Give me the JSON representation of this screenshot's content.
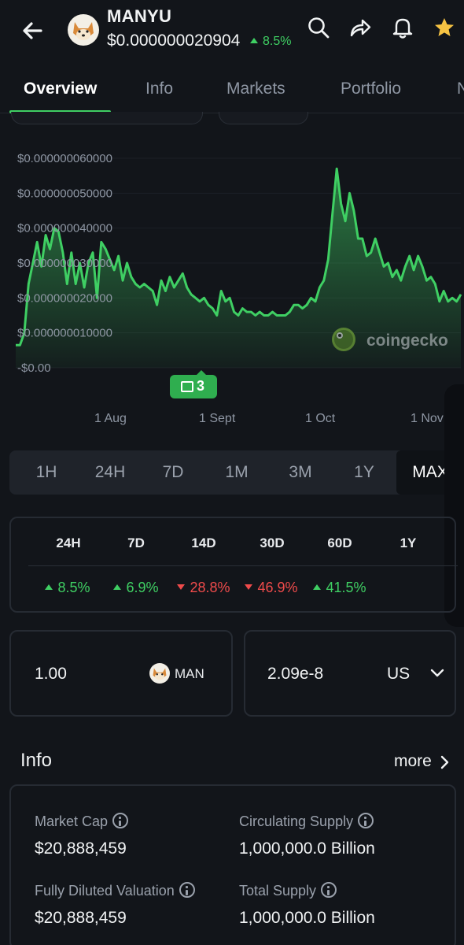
{
  "header": {
    "coin_name": "MANYU",
    "price": "$0.000000020904",
    "change_24h": "8.5%",
    "icons": [
      "back-arrow-icon",
      "search-icon",
      "share-icon",
      "bell-icon",
      "star-icon"
    ]
  },
  "tabs": [
    {
      "label": "Overview",
      "active": true
    },
    {
      "label": "Info",
      "active": false
    },
    {
      "label": "Markets",
      "active": false
    },
    {
      "label": "Portfolio",
      "active": false
    },
    {
      "label": "N",
      "active": false
    }
  ],
  "chart": {
    "watermark": "coingecko",
    "news_count": "3"
  },
  "chart_data": {
    "type": "area",
    "x_tick_labels": [
      "1 Aug",
      "1 Sept",
      "1 Oct",
      "1 Nov"
    ],
    "y_tick_labels": [
      "$0.000000060000",
      "$0.000000050000",
      "$0.000000040000",
      "$0.000000030000",
      "$0.000000020000",
      "$0.000000010000",
      "-$0.00"
    ],
    "ylim": [
      0,
      6e-08
    ],
    "grid": true,
    "color": "#3fcf63",
    "values": [
      6.5e-09,
      6.5e-09,
      1e-08,
      2.4e-08,
      3e-08,
      3.6e-08,
      2.9e-08,
      3.8e-08,
      3.4e-08,
      4e-08,
      3.9e-08,
      3.3e-08,
      2.4e-08,
      3.3e-08,
      2.4e-08,
      3e-08,
      2.3e-08,
      3e-08,
      3.3e-08,
      2e-08,
      3.6e-08,
      3.4e-08,
      3.1e-08,
      2.8e-08,
      3.2e-08,
      2.5e-08,
      3e-08,
      2.6e-08,
      2.4e-08,
      2.3e-08,
      2.4e-08,
      2.3e-08,
      2.2e-08,
      1.8e-08,
      2.5e-08,
      2.2e-08,
      2.6e-08,
      2.3e-08,
      2.5e-08,
      2.7e-08,
      2.3e-08,
      2.1e-08,
      2e-08,
      1.9e-08,
      2e-08,
      1.8e-08,
      1.7e-08,
      1.5e-08,
      2.2e-08,
      1.9e-08,
      2e-08,
      1.6e-08,
      1.5e-08,
      1.7e-08,
      1.6e-08,
      1.6e-08,
      1.5e-08,
      1.6e-08,
      1.5e-08,
      1.5e-08,
      1.6e-08,
      1.5e-08,
      1.5e-08,
      1.5e-08,
      1.6e-08,
      1.8e-08,
      1.8e-08,
      1.7e-08,
      1.8e-08,
      2e-08,
      1.9e-08,
      2.3e-08,
      2.5e-08,
      3.1e-08,
      4.4e-08,
      5.7e-08,
      4.7e-08,
      4.2e-08,
      5e-08,
      4.5e-08,
      3.7e-08,
      3.7e-08,
      3.2e-08,
      3.3e-08,
      3.7e-08,
      3.3e-08,
      2.9e-08,
      3e-08,
      2.6e-08,
      2.8e-08,
      2.5e-08,
      2.9e-08,
      3.2e-08,
      2.8e-08,
      3.2e-08,
      2.9e-08,
      2.5e-08,
      2.6e-08,
      2.4e-08,
      1.9e-08,
      2.2e-08,
      1.9e-08,
      2e-08,
      1.9e-08,
      2.1e-08
    ]
  },
  "time_ranges": [
    {
      "label": "1H",
      "active": false
    },
    {
      "label": "24H",
      "active": false
    },
    {
      "label": "7D",
      "active": false
    },
    {
      "label": "1M",
      "active": false
    },
    {
      "label": "3M",
      "active": false
    },
    {
      "label": "1Y",
      "active": false
    },
    {
      "label": "MAX",
      "active": true
    }
  ],
  "performance": [
    {
      "period": "24H",
      "change": "8.5%",
      "direction": "up"
    },
    {
      "period": "7D",
      "change": "6.9%",
      "direction": "up"
    },
    {
      "period": "14D",
      "change": "28.8%",
      "direction": "down"
    },
    {
      "period": "30D",
      "change": "46.9%",
      "direction": "down"
    },
    {
      "period": "60D",
      "change": "41.5%",
      "direction": "up"
    },
    {
      "period": "1Y",
      "change": "",
      "direction": "none"
    }
  ],
  "converter": {
    "amount": "1.00",
    "coin_symbol": "MAN",
    "value": "2.09e-8",
    "currency": "US"
  },
  "info": {
    "title": "Info",
    "more": "more",
    "stats": [
      {
        "label": "Market Cap",
        "value": "$20,888,459"
      },
      {
        "label": "Circulating Supply",
        "value": "1,000,000.0 Billion"
      },
      {
        "label": "Fully Diluted Valuation",
        "value": "$20,888,459"
      },
      {
        "label": "Total Supply",
        "value": "1,000,000.0 Billion"
      }
    ]
  },
  "colors": {
    "background": "#12151a",
    "accent_green": "#3fcf63",
    "negative_red": "#ef4b4b",
    "text_muted": "#8e96a3"
  }
}
